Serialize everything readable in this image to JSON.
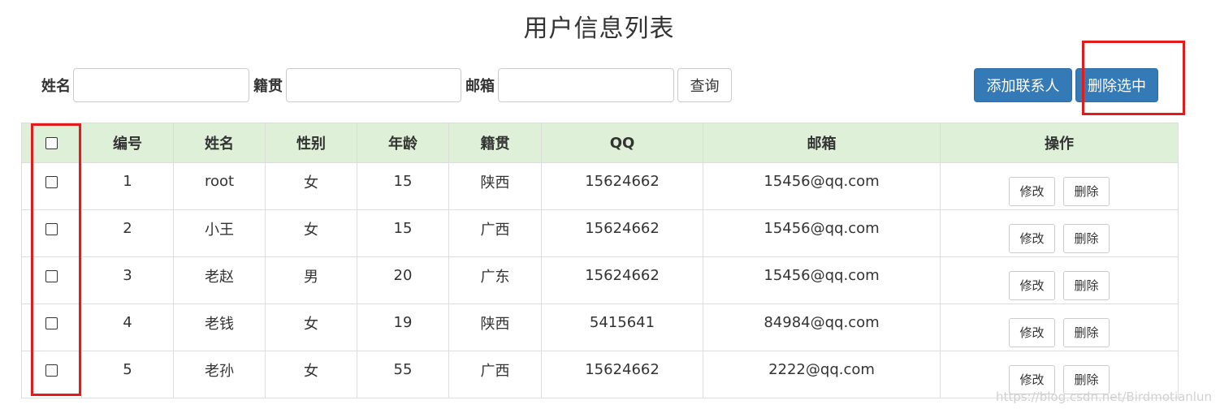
{
  "page": {
    "title": "用户信息列表"
  },
  "search": {
    "name_label": "姓名",
    "name_value": "",
    "origin_label": "籍贯",
    "origin_value": "",
    "email_label": "邮箱",
    "email_value": "",
    "query_label": "查询"
  },
  "actions": {
    "add_label": "添加联系人",
    "delete_selected_label": "删除选中"
  },
  "table": {
    "headers": [
      "编号",
      "姓名",
      "性别",
      "年龄",
      "籍贯",
      "QQ",
      "邮箱",
      "操作"
    ],
    "rows": [
      {
        "id": "1",
        "name": "root",
        "gender": "女",
        "age": "15",
        "origin": "陕西",
        "qq": "15624662",
        "email": "15456@qq.com"
      },
      {
        "id": "2",
        "name": "小王",
        "gender": "女",
        "age": "15",
        "origin": "广西",
        "qq": "15624662",
        "email": "15456@qq.com"
      },
      {
        "id": "3",
        "name": "老赵",
        "gender": "男",
        "age": "20",
        "origin": "广东",
        "qq": "15624662",
        "email": "15456@qq.com"
      },
      {
        "id": "4",
        "name": "老钱",
        "gender": "女",
        "age": "19",
        "origin": "陕西",
        "qq": "5415641",
        "email": "84984@qq.com"
      },
      {
        "id": "5",
        "name": "老孙",
        "gender": "女",
        "age": "55",
        "origin": "广西",
        "qq": "15624662",
        "email": "2222@qq.com"
      }
    ],
    "edit_label": "修改",
    "delete_label": "删除"
  },
  "colors": {
    "header_bg": "#dff0d8",
    "primary": "#337ab7",
    "highlight": "#e41b1b"
  },
  "watermark": "https://blog.csdn.net/Birdmotianlun"
}
